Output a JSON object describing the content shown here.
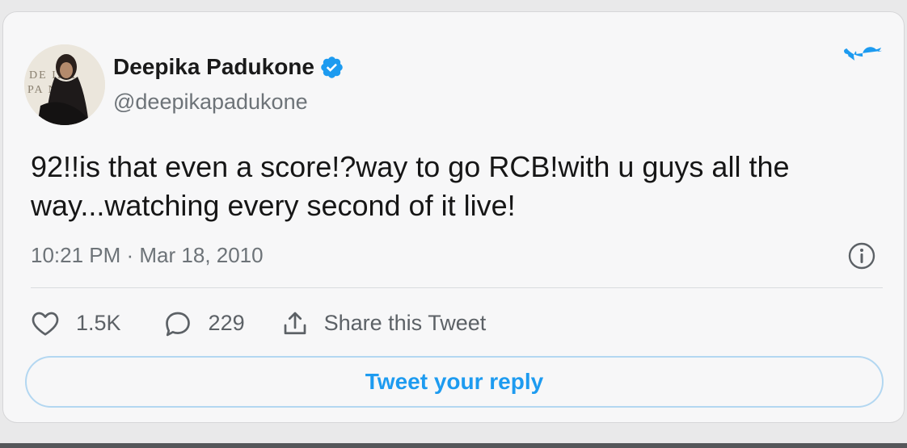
{
  "tweet": {
    "author_name": "Deepika Padukone",
    "author_handle": "@deepikapadukone",
    "text": "92!!is that even a score!?way to go RCB!with u guys all the way...watching every second of it live!",
    "timestamp": "10:21 PM · Mar 18, 2010",
    "verified": true,
    "avatar_text": "DEEPIKA PADUKONE"
  },
  "actions": {
    "like_count": "1.5K",
    "reply_count": "229",
    "share_label": "Share this Tweet"
  },
  "reply_button_label": "Tweet your reply",
  "icons": {
    "brand": "twitter-bird-icon",
    "verified": "verified-badge-icon",
    "info": "info-icon",
    "like": "heart-icon",
    "reply": "comment-icon",
    "share": "share-icon"
  },
  "colors": {
    "twitter_blue": "#1d9bf0",
    "text_primary": "#161616",
    "text_secondary": "#6d7378",
    "card_background": "#f7f7f8"
  }
}
